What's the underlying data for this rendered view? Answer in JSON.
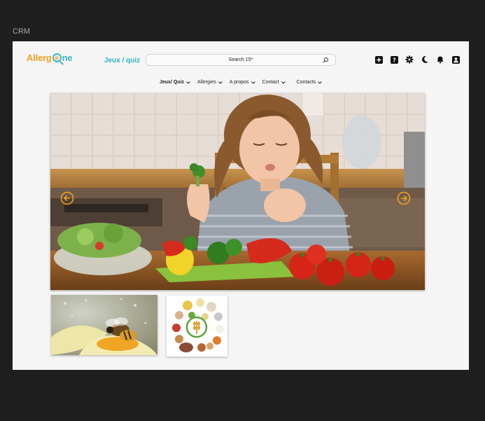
{
  "window": {
    "title": "CRM"
  },
  "header": {
    "logo": {
      "part1": "Allerg",
      "part2": "e",
      "part3": "ne"
    },
    "jeux_link": "Jeux / quiz",
    "search": {
      "placeholder": "Search 15*"
    },
    "icons": [
      "plus-square-icon",
      "help-icon",
      "gear-icon",
      "moon-icon",
      "bell-icon",
      "user-icon"
    ]
  },
  "nav": {
    "items": [
      {
        "label": "Jeux/ Quiz",
        "active": true
      },
      {
        "label": "Allergies",
        "active": false
      },
      {
        "label": "A propos",
        "active": false
      },
      {
        "label": "Contact",
        "active": false
      },
      {
        "label": "Contacts",
        "active": false
      }
    ]
  },
  "carousel": {
    "main_image": "child-eating-vegetables-photo",
    "thumbnails": [
      "bee-on-flower-photo",
      "allergen-foods-photo"
    ]
  },
  "colors": {
    "accent": "#2bb3c2",
    "logo_orange": "#f0a020",
    "arrow": "#f0a020"
  }
}
